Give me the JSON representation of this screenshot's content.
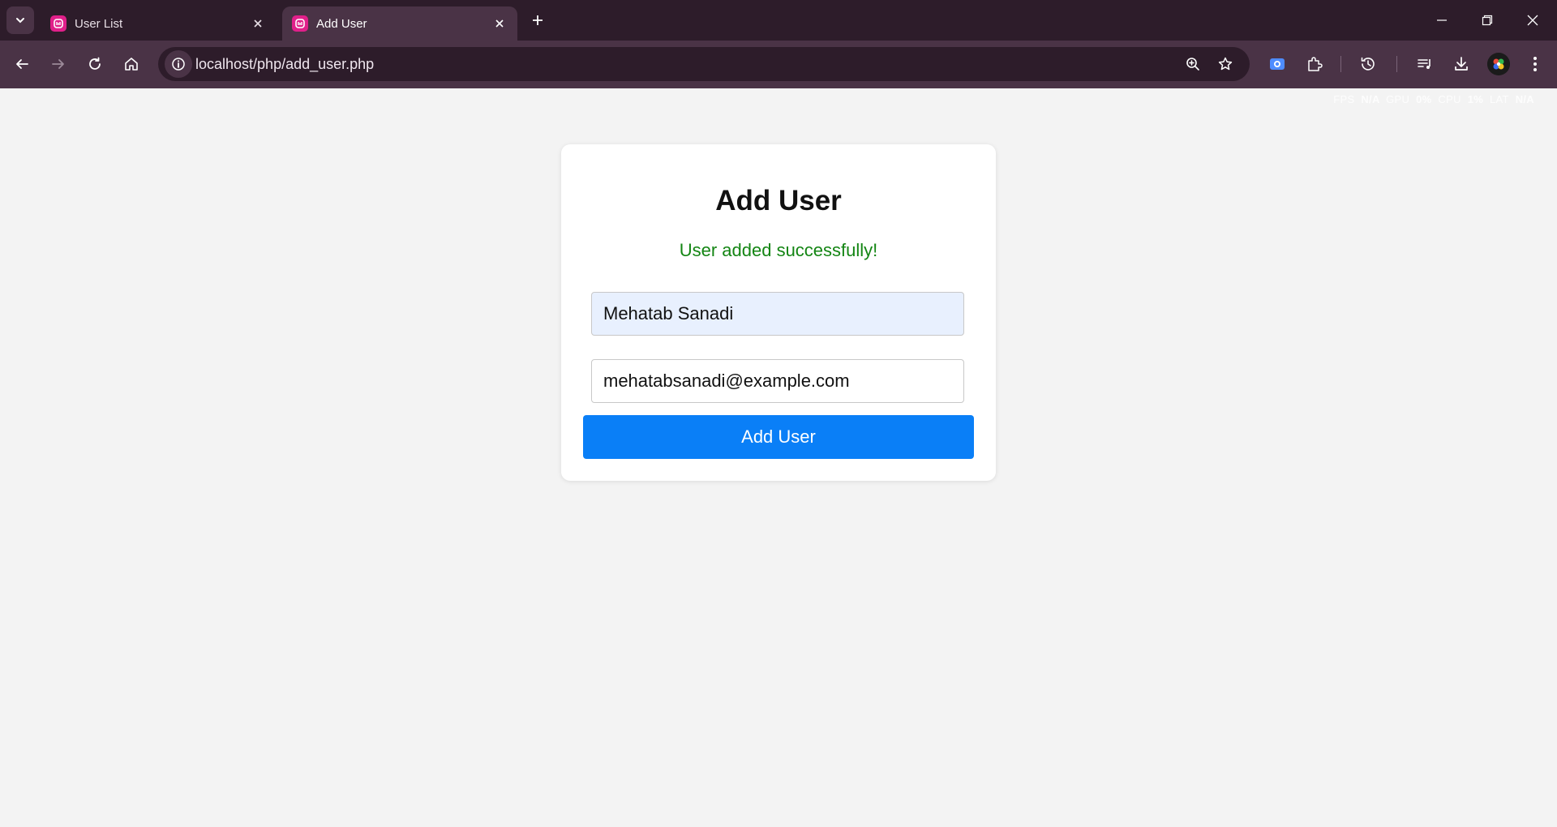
{
  "browser": {
    "tabs": [
      {
        "title": "User List",
        "active": false
      },
      {
        "title": "Add User",
        "active": true
      }
    ],
    "url": "localhost/php/add_user.php",
    "accent_color": "#e0208a"
  },
  "perf_overlay": {
    "fps_label": "FPS",
    "fps_value": "N/A",
    "gpu_label": "GPU",
    "gpu_value": "0%",
    "cpu_label": "CPU",
    "cpu_value": "1%",
    "lat_label": "LAT",
    "lat_value": "N/A"
  },
  "form": {
    "heading": "Add User",
    "success_message": "User added successfully!",
    "success_color": "#138513",
    "name_value": "Mehatab Sanadi",
    "email_value": "mehatabsanadi@example.com",
    "submit_label": "Add User",
    "button_color": "#0a7ff7"
  },
  "icons": {
    "tab_search": "chevron-down-icon",
    "favicon": "app-favicon-icon",
    "tab_close": "close-icon",
    "new_tab": "plus-icon",
    "back": "back-arrow-icon",
    "forward": "forward-arrow-icon",
    "reload": "reload-icon",
    "home": "home-icon",
    "site_info": "info-icon",
    "zoom": "zoom-icon",
    "bookmark": "star-icon",
    "screenshot_extension": "camera-icon",
    "extensions": "puzzle-icon",
    "history": "history-icon",
    "media": "media-queue-icon",
    "downloads": "download-icon",
    "profile": "avatar",
    "menu": "kebab-menu-icon"
  }
}
